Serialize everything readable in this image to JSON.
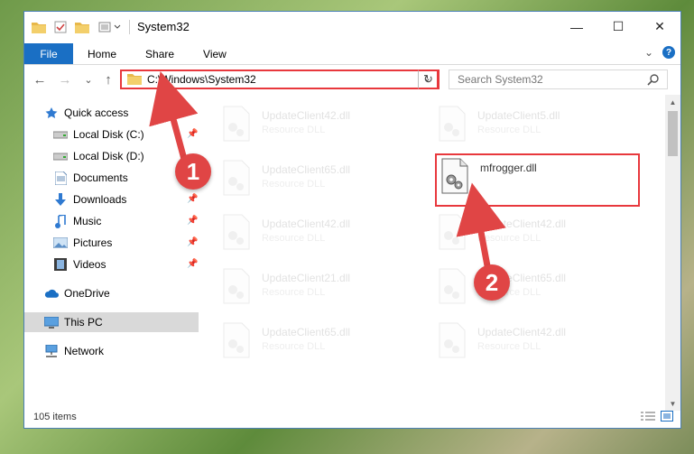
{
  "window": {
    "title": "System32",
    "controls": {
      "minimize": "—",
      "maximize": "☐",
      "close": "✕"
    }
  },
  "ribbon": {
    "tabs": [
      "File",
      "Home",
      "Share",
      "View"
    ],
    "collapse": "⌄",
    "help": "?"
  },
  "nav": {
    "back": "←",
    "forward": "→",
    "recent": "⌄",
    "up": "↑",
    "address": "C:\\Windows\\System32",
    "address_dropdown": "⌄",
    "refresh": "↻",
    "search_placeholder": "Search System32"
  },
  "sidebar": {
    "items": [
      {
        "label": "Quick access",
        "icon": "star-icon",
        "pinned": false
      },
      {
        "label": "Local Disk (C:)",
        "icon": "drive-icon",
        "pinned": true
      },
      {
        "label": "Local Disk (D:)",
        "icon": "drive-icon",
        "pinned": false
      },
      {
        "label": "Documents",
        "icon": "documents-icon",
        "pinned": true
      },
      {
        "label": "Downloads",
        "icon": "download-icon",
        "pinned": true
      },
      {
        "label": "Music",
        "icon": "music-icon",
        "pinned": true
      },
      {
        "label": "Pictures",
        "icon": "pictures-icon",
        "pinned": true
      },
      {
        "label": "Videos",
        "icon": "videos-icon",
        "pinned": true
      },
      {
        "label": "OneDrive",
        "icon": "cloud-icon",
        "pinned": false
      },
      {
        "label": "This PC",
        "icon": "pc-icon",
        "pinned": false,
        "selected": true
      },
      {
        "label": "Network",
        "icon": "network-icon",
        "pinned": false
      }
    ],
    "pin_glyph": "📌"
  },
  "files": [
    {
      "name": "UpdateClient42.dll",
      "type": "Resource DLL",
      "faded": true
    },
    {
      "name": "UpdateClient5.dll",
      "type": "Resource DLL",
      "faded": true
    },
    {
      "name": "UpdateClient65.dll",
      "type": "Resource DLL",
      "faded": true
    },
    {
      "name": "mfrogger.dll",
      "type": "",
      "faded": false
    },
    {
      "name": "UpdateClient42.dll",
      "type": "Resource DLL",
      "faded": true
    },
    {
      "name": "UpdateClient42.dll",
      "type": "Resource DLL",
      "faded": true
    },
    {
      "name": "UpdateClient21.dll",
      "type": "Resource DLL",
      "faded": true
    },
    {
      "name": "UpdateClient65.dll",
      "type": "Resource DLL",
      "faded": true
    },
    {
      "name": "UpdateClient65.dll",
      "type": "Resource DLL",
      "faded": true
    },
    {
      "name": "UpdateClient42.dll",
      "type": "Resource DLL",
      "faded": true
    }
  ],
  "status": {
    "item_count": "105 items"
  },
  "annotations": {
    "step1": "1",
    "step2": "2"
  },
  "colors": {
    "accent": "#1a6fc4",
    "highlight": "#e8383d",
    "callout": "#e04545"
  }
}
